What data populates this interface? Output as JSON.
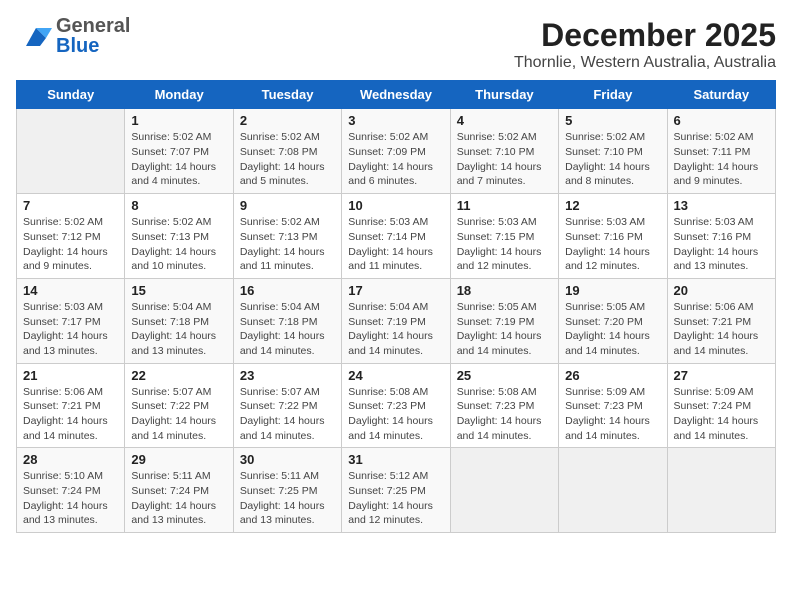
{
  "header": {
    "logo_general": "General",
    "logo_blue": "Blue",
    "title": "December 2025",
    "subtitle": "Thornlie, Western Australia, Australia"
  },
  "calendar": {
    "days_of_week": [
      "Sunday",
      "Monday",
      "Tuesday",
      "Wednesday",
      "Thursday",
      "Friday",
      "Saturday"
    ],
    "weeks": [
      [
        {
          "date": "",
          "details": ""
        },
        {
          "date": "1",
          "details": "Sunrise: 5:02 AM\nSunset: 7:07 PM\nDaylight: 14 hours\nand 4 minutes."
        },
        {
          "date": "2",
          "details": "Sunrise: 5:02 AM\nSunset: 7:08 PM\nDaylight: 14 hours\nand 5 minutes."
        },
        {
          "date": "3",
          "details": "Sunrise: 5:02 AM\nSunset: 7:09 PM\nDaylight: 14 hours\nand 6 minutes."
        },
        {
          "date": "4",
          "details": "Sunrise: 5:02 AM\nSunset: 7:10 PM\nDaylight: 14 hours\nand 7 minutes."
        },
        {
          "date": "5",
          "details": "Sunrise: 5:02 AM\nSunset: 7:10 PM\nDaylight: 14 hours\nand 8 minutes."
        },
        {
          "date": "6",
          "details": "Sunrise: 5:02 AM\nSunset: 7:11 PM\nDaylight: 14 hours\nand 9 minutes."
        }
      ],
      [
        {
          "date": "7",
          "details": "Sunrise: 5:02 AM\nSunset: 7:12 PM\nDaylight: 14 hours\nand 9 minutes."
        },
        {
          "date": "8",
          "details": "Sunrise: 5:02 AM\nSunset: 7:13 PM\nDaylight: 14 hours\nand 10 minutes."
        },
        {
          "date": "9",
          "details": "Sunrise: 5:02 AM\nSunset: 7:13 PM\nDaylight: 14 hours\nand 11 minutes."
        },
        {
          "date": "10",
          "details": "Sunrise: 5:03 AM\nSunset: 7:14 PM\nDaylight: 14 hours\nand 11 minutes."
        },
        {
          "date": "11",
          "details": "Sunrise: 5:03 AM\nSunset: 7:15 PM\nDaylight: 14 hours\nand 12 minutes."
        },
        {
          "date": "12",
          "details": "Sunrise: 5:03 AM\nSunset: 7:16 PM\nDaylight: 14 hours\nand 12 minutes."
        },
        {
          "date": "13",
          "details": "Sunrise: 5:03 AM\nSunset: 7:16 PM\nDaylight: 14 hours\nand 13 minutes."
        }
      ],
      [
        {
          "date": "14",
          "details": "Sunrise: 5:03 AM\nSunset: 7:17 PM\nDaylight: 14 hours\nand 13 minutes."
        },
        {
          "date": "15",
          "details": "Sunrise: 5:04 AM\nSunset: 7:18 PM\nDaylight: 14 hours\nand 13 minutes."
        },
        {
          "date": "16",
          "details": "Sunrise: 5:04 AM\nSunset: 7:18 PM\nDaylight: 14 hours\nand 14 minutes."
        },
        {
          "date": "17",
          "details": "Sunrise: 5:04 AM\nSunset: 7:19 PM\nDaylight: 14 hours\nand 14 minutes."
        },
        {
          "date": "18",
          "details": "Sunrise: 5:05 AM\nSunset: 7:19 PM\nDaylight: 14 hours\nand 14 minutes."
        },
        {
          "date": "19",
          "details": "Sunrise: 5:05 AM\nSunset: 7:20 PM\nDaylight: 14 hours\nand 14 minutes."
        },
        {
          "date": "20",
          "details": "Sunrise: 5:06 AM\nSunset: 7:21 PM\nDaylight: 14 hours\nand 14 minutes."
        }
      ],
      [
        {
          "date": "21",
          "details": "Sunrise: 5:06 AM\nSunset: 7:21 PM\nDaylight: 14 hours\nand 14 minutes."
        },
        {
          "date": "22",
          "details": "Sunrise: 5:07 AM\nSunset: 7:22 PM\nDaylight: 14 hours\nand 14 minutes."
        },
        {
          "date": "23",
          "details": "Sunrise: 5:07 AM\nSunset: 7:22 PM\nDaylight: 14 hours\nand 14 minutes."
        },
        {
          "date": "24",
          "details": "Sunrise: 5:08 AM\nSunset: 7:23 PM\nDaylight: 14 hours\nand 14 minutes."
        },
        {
          "date": "25",
          "details": "Sunrise: 5:08 AM\nSunset: 7:23 PM\nDaylight: 14 hours\nand 14 minutes."
        },
        {
          "date": "26",
          "details": "Sunrise: 5:09 AM\nSunset: 7:23 PM\nDaylight: 14 hours\nand 14 minutes."
        },
        {
          "date": "27",
          "details": "Sunrise: 5:09 AM\nSunset: 7:24 PM\nDaylight: 14 hours\nand 14 minutes."
        }
      ],
      [
        {
          "date": "28",
          "details": "Sunrise: 5:10 AM\nSunset: 7:24 PM\nDaylight: 14 hours\nand 13 minutes."
        },
        {
          "date": "29",
          "details": "Sunrise: 5:11 AM\nSunset: 7:24 PM\nDaylight: 14 hours\nand 13 minutes."
        },
        {
          "date": "30",
          "details": "Sunrise: 5:11 AM\nSunset: 7:25 PM\nDaylight: 14 hours\nand 13 minutes."
        },
        {
          "date": "31",
          "details": "Sunrise: 5:12 AM\nSunset: 7:25 PM\nDaylight: 14 hours\nand 12 minutes."
        },
        {
          "date": "",
          "details": ""
        },
        {
          "date": "",
          "details": ""
        },
        {
          "date": "",
          "details": ""
        }
      ]
    ]
  }
}
